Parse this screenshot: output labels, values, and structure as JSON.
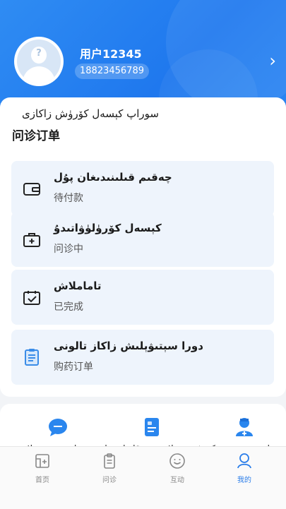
{
  "profile": {
    "username": "用户12345",
    "phone": "18823456789"
  },
  "orders": {
    "title_ug": "سوراپ كېسەل كۆرۈش زاكازى",
    "title_cn": "问诊订单",
    "items": [
      {
        "ug": "چەقىم قىلىنىدىغان پۇل",
        "cn": "待付款",
        "icon": "wallet-icon"
      },
      {
        "ug": "كېسەل كۆرۈلۈۋاتىدۇ",
        "cn": "问诊中",
        "icon": "medical-kit-icon"
      },
      {
        "ug": "تاماملاش",
        "cn": "已完成",
        "icon": "completed-check-icon"
      },
      {
        "ug": "دورا سېتىۋېلىش زاكاز تالونى",
        "cn": "购药订单",
        "icon": "receipt-icon"
      }
    ]
  },
  "tools": {
    "partial_text": "بىر تاشقى دوختۇر كۆرۈش مۇلازىمىتى قانداق ئېلىپ بېرىلىدۇ  دوختۇرلار ئىشى"
  },
  "tabbar": {
    "items": [
      {
        "label": "首页",
        "icon": "home-icon",
        "active": false
      },
      {
        "label": "问诊",
        "icon": "consultation-icon",
        "active": false
      },
      {
        "label": "互动",
        "icon": "interaction-icon",
        "active": false
      },
      {
        "label": "我的",
        "icon": "profile-icon",
        "active": true
      }
    ]
  },
  "colors": {
    "primary": "#2a7de9",
    "hero": "#1f78ee",
    "row_bg": "#eef4fc"
  }
}
